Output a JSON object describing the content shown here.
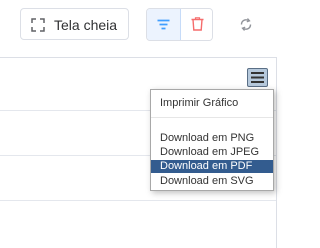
{
  "toolbar": {
    "fullscreen_label": "Tela cheia",
    "fullscreen_icon": "fullscreen-icon",
    "filter_icon": "filter-icon",
    "delete_icon": "trash-icon",
    "refresh_icon": "refresh-icon",
    "colors": {
      "filter": "#409eff",
      "delete": "#f56c6c",
      "refresh": "#909399"
    }
  },
  "chart": {
    "menu_icon": "hamburger-menu-icon",
    "context_menu": {
      "items": [
        {
          "label": "Imprimir Gráfico",
          "active": false
        },
        {
          "label": "Download em PNG",
          "active": false
        },
        {
          "label": "Download em JPEG",
          "active": false
        },
        {
          "label": "Download em PDF",
          "active": true
        },
        {
          "label": "Download em SVG",
          "active": false
        }
      ],
      "active_color": "#335c8f"
    }
  }
}
